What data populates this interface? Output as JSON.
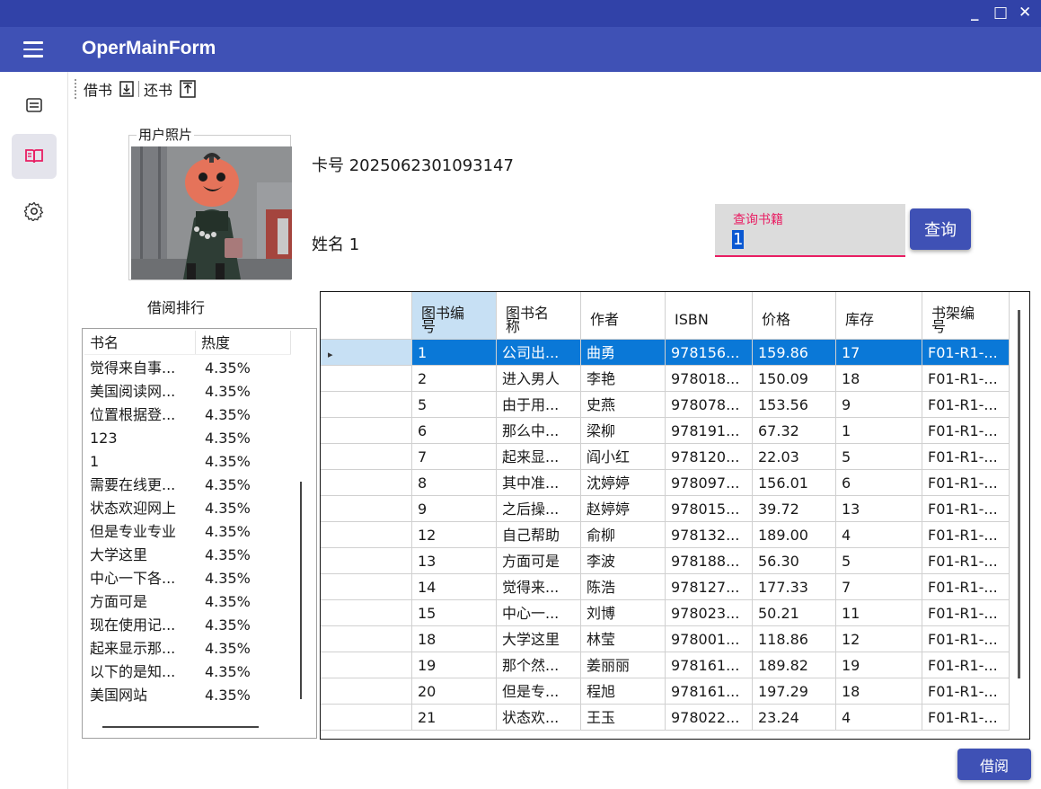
{
  "window": {
    "controls": [
      "_",
      "□",
      "✕"
    ]
  },
  "appbar": {
    "title": "OperMainForm"
  },
  "sidenav": {
    "items": [
      "list-icon",
      "book-icon",
      "gear-icon"
    ],
    "active_index": 1,
    "accent": "#e91e63"
  },
  "toolbar": {
    "borrow_label": "借书",
    "return_label": "还书"
  },
  "user": {
    "photo_label": "用户照片",
    "card": "卡号 2025062301093147",
    "name": "姓名 1"
  },
  "search": {
    "label": "查询书籍",
    "value": "1",
    "button": "查询"
  },
  "ranking": {
    "title": "借阅排行",
    "headers": [
      "书名",
      "热度"
    ],
    "rows": [
      [
        "觉得来自事...",
        "4.35%"
      ],
      [
        "美国阅读网...",
        "4.35%"
      ],
      [
        "位置根据登...",
        "4.35%"
      ],
      [
        "123",
        "4.35%"
      ],
      [
        "1",
        "4.35%"
      ],
      [
        "需要在线更...",
        "4.35%"
      ],
      [
        "状态欢迎网上",
        "4.35%"
      ],
      [
        "但是专业专业",
        "4.35%"
      ],
      [
        "大学这里",
        "4.35%"
      ],
      [
        "中心一下各...",
        "4.35%"
      ],
      [
        "方面可是",
        "4.35%"
      ],
      [
        "现在使用记...",
        "4.35%"
      ],
      [
        "起来显示那...",
        "4.35%"
      ],
      [
        "以下的是知...",
        "4.35%"
      ],
      [
        "美国网站",
        "4.35%"
      ]
    ]
  },
  "books": {
    "headers": [
      "图书编号",
      "图书名称",
      "作者",
      "ISBN",
      "价格",
      "库存",
      "书架编号"
    ],
    "selected_row": 0,
    "rows": [
      [
        "1",
        "公司出...",
        "曲勇",
        "978156...",
        "159.86",
        "17",
        "F01-R1-..."
      ],
      [
        "2",
        "进入男人",
        "李艳",
        "978018...",
        "150.09",
        "18",
        "F01-R1-..."
      ],
      [
        "5",
        "由于用...",
        "史燕",
        "978078...",
        "153.56",
        "9",
        "F01-R1-..."
      ],
      [
        "6",
        "那么中...",
        "梁柳",
        "978191...",
        "67.32",
        "1",
        "F01-R1-..."
      ],
      [
        "7",
        "起来显...",
        "阎小红",
        "978120...",
        "22.03",
        "5",
        "F01-R1-..."
      ],
      [
        "8",
        "其中准...",
        "沈婷婷",
        "978097...",
        "156.01",
        "6",
        "F01-R1-..."
      ],
      [
        "9",
        "之后操...",
        "赵婷婷",
        "978015...",
        "39.72",
        "13",
        "F01-R1-..."
      ],
      [
        "12",
        "自己帮助",
        "俞柳",
        "978132...",
        "189.00",
        "4",
        "F01-R1-..."
      ],
      [
        "13",
        "方面可是",
        "李波",
        "978188...",
        "56.30",
        "5",
        "F01-R1-..."
      ],
      [
        "14",
        "觉得来...",
        "陈浩",
        "978127...",
        "177.33",
        "7",
        "F01-R1-..."
      ],
      [
        "15",
        "中心一...",
        "刘博",
        "978023...",
        "50.21",
        "11",
        "F01-R1-..."
      ],
      [
        "18",
        "大学这里",
        "林莹",
        "978001...",
        "118.86",
        "12",
        "F01-R1-..."
      ],
      [
        "19",
        "那个然...",
        "姜丽丽",
        "978161...",
        "189.82",
        "19",
        "F01-R1-..."
      ],
      [
        "20",
        "但是专...",
        "程旭",
        "978161...",
        "197.29",
        "18",
        "F01-R1-..."
      ],
      [
        "21",
        "状态欢...",
        "王玉",
        "978022...",
        "23.24",
        "4",
        "F01-R1-..."
      ]
    ]
  },
  "actions": {
    "borrow_button": "借阅"
  },
  "colors": {
    "titlebar": "#3142a8",
    "appbar": "#3f51b5",
    "selection": "#0a78d7",
    "header_selected": "#c7e0f4"
  }
}
